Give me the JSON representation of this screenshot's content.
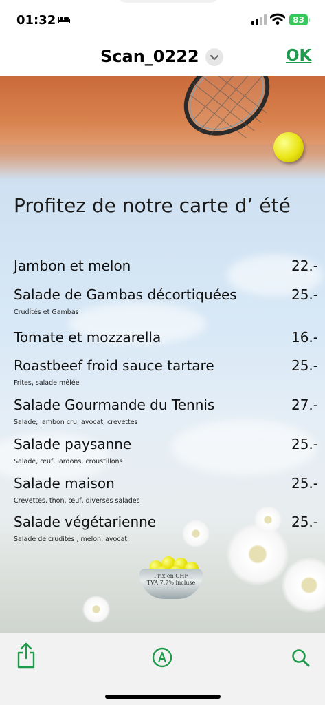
{
  "status_bar": {
    "time": "01:32",
    "battery": "83"
  },
  "nav": {
    "title": "Scan_0222",
    "ok_label": "OK"
  },
  "document": {
    "heading": "Profitez de notre carte d’ été",
    "items": [
      {
        "name": "Jambon et melon",
        "price": "22.-",
        "description": ""
      },
      {
        "name": "Salade de Gambas décortiquées",
        "price": "25.-",
        "description": "Crudités et Gambas"
      },
      {
        "name": "Tomate et mozzarella",
        "price": "16.-",
        "description": ""
      },
      {
        "name": "Roastbeef froid sauce tartare",
        "price": "25.-",
        "description": "Frites, salade mêlée"
      },
      {
        "name": "Salade Gourmande du Tennis",
        "price": "27.-",
        "description": "Salade, jambon cru, avocat, crevettes"
      },
      {
        "name": "Salade paysanne",
        "price": "25.-",
        "description": "Salade, œuf, lardons, croustillons"
      },
      {
        "name": "Salade maison",
        "price": "25.-",
        "description": "Crevettes, thon, œuf, diverses salades"
      },
      {
        "name": "Salade végétarienne",
        "price": "25.-",
        "description": "Salade de crudités , melon, avocat"
      }
    ],
    "basket_line1": "Prix en CHF",
    "basket_line2": "TVA 7,7% incluse"
  },
  "colors": {
    "accent": "#1f9b4d",
    "battery": "#34c759"
  },
  "toolbar": {
    "icons": [
      "share-icon",
      "markup-icon",
      "search-icon"
    ]
  }
}
